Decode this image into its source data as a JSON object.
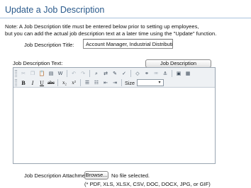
{
  "header": {
    "title": "Update a Job Description"
  },
  "note": {
    "line1": "Note: A Job Description title must be entered below prior to setting up employees,",
    "line2": "but you can add the actual job description text at a later time using the \"Update\" function."
  },
  "form": {
    "title_label": "Job Description Title:",
    "title_value": "Account Manager, Industrial Distribution",
    "text_label": "Job Description Text:",
    "suggestions_button": "Job Description Suggestions",
    "attachment_label": "Job Description Attachment:",
    "browse_button": "Browse...",
    "file_status": "No file selected.",
    "file_types": "(* PDF, XLS, XLSX, CSV, DOC, DOCX, JPG, or GIF)"
  },
  "editor": {
    "size_label": "Size",
    "size_value": "",
    "toolbar_row1": [
      "cut-icon",
      "copy-icon",
      "paste-icon",
      "paste-text-icon",
      "paste-word-icon",
      "undo-icon",
      "redo-icon",
      "find-icon",
      "replace-icon",
      "eraser-icon",
      "spellcheck-icon",
      "source-icon",
      "link-icon",
      "unlink-icon",
      "anchor-icon",
      "image-icon",
      "table-icon"
    ],
    "toolbar_row2": [
      "bold-icon",
      "italic-icon",
      "underline-icon",
      "strikethrough-icon",
      "subscript-icon",
      "superscript-icon",
      "numbered-list-icon",
      "bulleted-list-icon",
      "outdent-icon",
      "indent-icon"
    ],
    "glyphs": {
      "bold": "B",
      "italic": "I",
      "underline": "U",
      "strike": "abc",
      "sub": "x₂",
      "sup": "x²"
    }
  },
  "colors": {
    "title": "#2a5a8c",
    "rule": "#a9c3dd",
    "toolbar_bg": "#eef1f4"
  }
}
